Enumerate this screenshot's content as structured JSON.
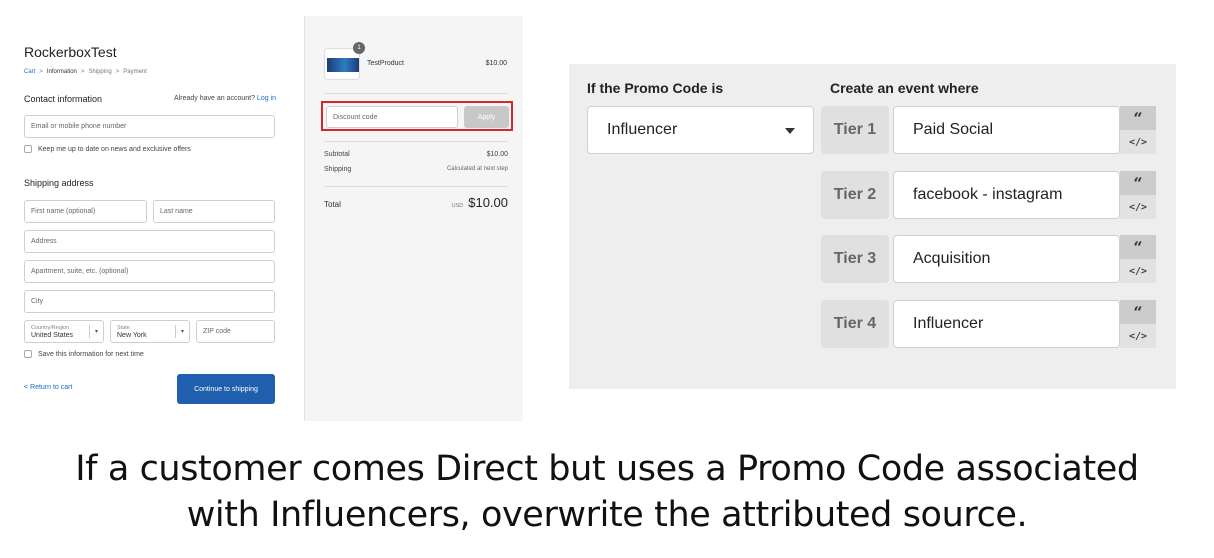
{
  "checkout": {
    "store_name": "RockerboxTest",
    "breadcrumb": [
      "Cart",
      "Information",
      "Shipping",
      "Payment"
    ],
    "breadcrumb_sep": ">",
    "contact_title": "Contact information",
    "account_question": "Already have an account?",
    "login_link": "Log in",
    "email_placeholder": "Email or mobile phone number",
    "newsletter_label": "Keep me up to date on news and exclusive offers",
    "shipping_title": "Shipping address",
    "first_name_placeholder": "First name (optional)",
    "last_name_placeholder": "Last name",
    "address_placeholder": "Address",
    "apartment_placeholder": "Apartment, suite, etc. (optional)",
    "city_placeholder": "City",
    "country_label": "Country/Region",
    "country_value": "United States",
    "state_label": "State",
    "state_value": "New York",
    "zip_placeholder": "ZIP code",
    "save_info_label": "Save this information for next time",
    "return_link": "< Return to cart",
    "continue_button": "Continue to shipping"
  },
  "summary": {
    "quantity": "1",
    "product_name": "TestProduct",
    "product_price": "$10.00",
    "discount_placeholder": "Discount code",
    "apply_button": "Apply",
    "subtotal_label": "Subtotal",
    "subtotal_value": "$10.00",
    "shipping_label": "Shipping",
    "shipping_value": "Calculated at next step",
    "total_label": "Total",
    "total_currency": "USD",
    "total_value": "$10.00"
  },
  "rule": {
    "promo_heading": "If the Promo Code is",
    "event_heading": "Create an event where",
    "promo_value": "Influencer",
    "tiers": [
      {
        "label": "Tier 1",
        "value": "Paid Social"
      },
      {
        "label": "Tier 2",
        "value": "facebook - instagram"
      },
      {
        "label": "Tier 3",
        "value": "Acquisition"
      },
      {
        "label": "Tier 4",
        "value": "Influencer"
      }
    ],
    "quote_glyph": "“",
    "code_glyph": "</>"
  },
  "caption": {
    "line1": "If a customer comes Direct but uses a Promo Code associated",
    "line2": "with Influencers, overwrite the attributed source."
  }
}
